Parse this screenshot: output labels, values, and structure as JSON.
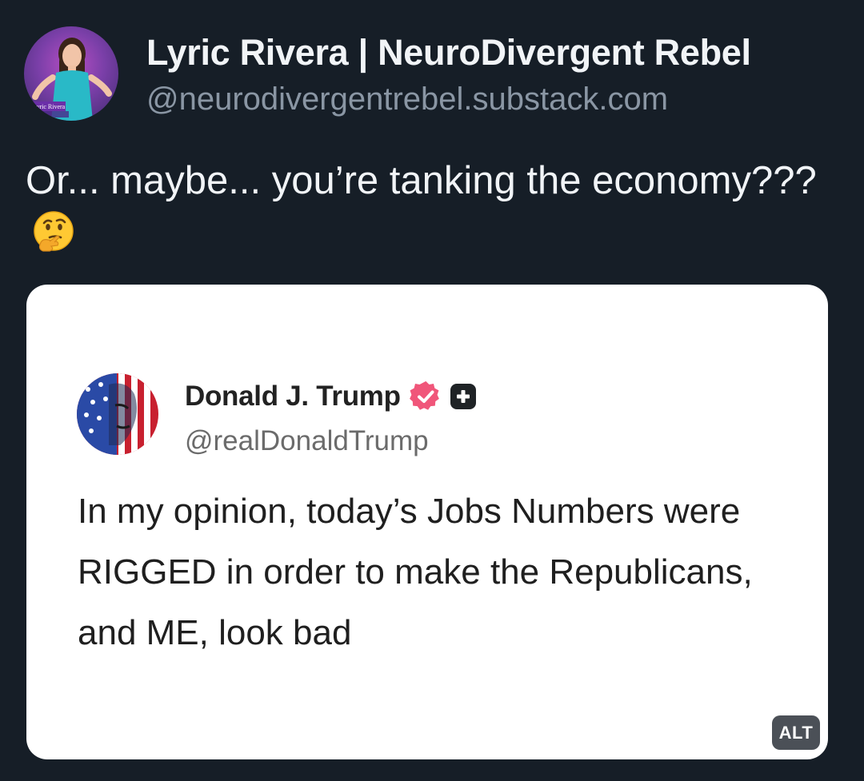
{
  "post": {
    "author": {
      "display_name": "Lyric Rivera | NeuroDivergent Rebel",
      "handle": "@neurodivergentrebel.substack.com",
      "avatar_icon": "profile-photo"
    },
    "text": "Or... maybe... you’re tanking the economy???",
    "emoji": "thinking-face"
  },
  "embed": {
    "author": {
      "display_name": "Donald J. Trump",
      "handle": "@realDonaldTrump",
      "verified_icon": "verified-badge-icon",
      "badge_icon": "plus-badge-icon",
      "avatar_icon": "flag-portrait"
    },
    "text": "In my opinion, today’s Jobs Numbers were RIGGED in order to make the Republicans, and ME, look bad",
    "alt_label": "ALT"
  },
  "colors": {
    "background": "#161e27",
    "primary_text": "#f1f4f7",
    "secondary_text": "#8a96a4",
    "card_background": "#ffffff",
    "verified_badge": "#f0567a"
  }
}
